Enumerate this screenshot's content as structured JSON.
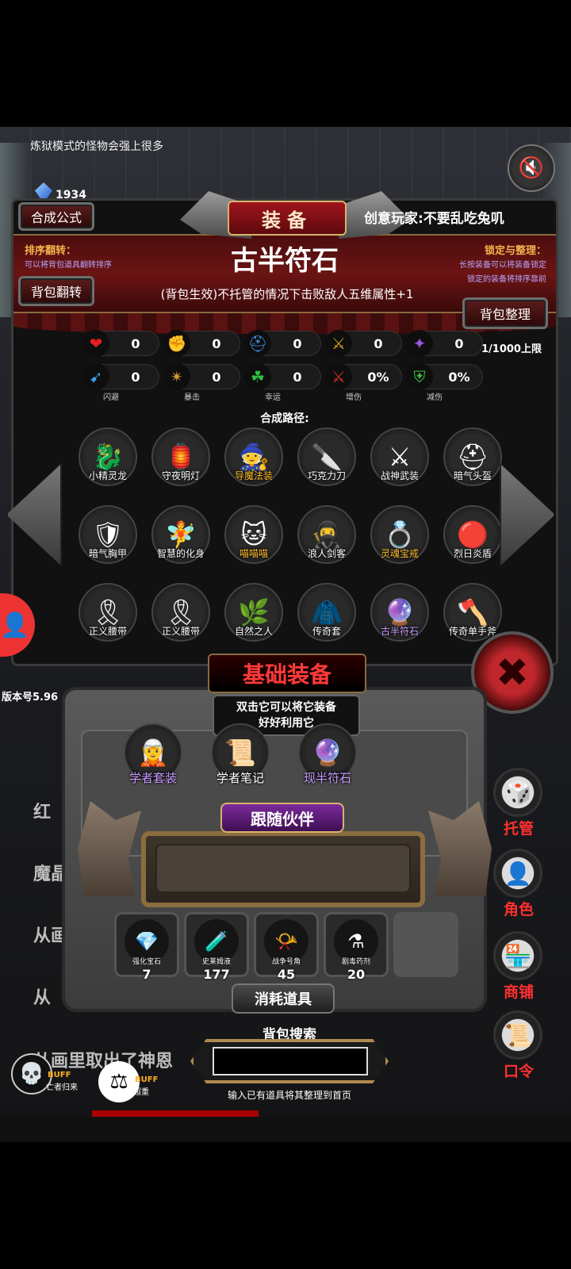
{
  "hint": "炼狱模式的怪物会强上很多",
  "currency": {
    "gems": "1934"
  },
  "header": {
    "title": "装备",
    "player": "创意玩家:不要乱吃兔叽",
    "synth_btn": "合成公式",
    "flip_label": "排序翻转：",
    "flip_sub": "可以将背包道具翻转排序",
    "flip_btn": "背包翻转",
    "lock_label": "锁定与整理：",
    "lock_sub1": "长按装备可以将装备锁定",
    "lock_sub2": "锁定的装备将排序靠前",
    "sort_btn": "背包整理"
  },
  "item": {
    "name": "古半符石",
    "desc": "(背包生效)不托管的情况下击败敌人五维属性+1"
  },
  "stats": [
    {
      "icon": "heart-icon",
      "glyph": "❤",
      "color": "#e02020",
      "value": "0",
      "label": ""
    },
    {
      "icon": "strength-icon",
      "glyph": "✊",
      "color": "#e4b526",
      "value": "0",
      "label": ""
    },
    {
      "icon": "helmet-icon",
      "glyph": "⛑",
      "color": "#3a8fe0",
      "value": "0",
      "label": ""
    },
    {
      "icon": "sword-icon",
      "glyph": "⚔",
      "color": "#d9a020",
      "value": "0",
      "label": ""
    },
    {
      "icon": "magic-icon",
      "glyph": "✦",
      "color": "#9b58e6",
      "value": "0",
      "label": ""
    },
    {
      "icon": "dodge-icon",
      "glyph": "➹",
      "color": "#3aa0f0",
      "value": "0",
      "label": "闪避"
    },
    {
      "icon": "crit-icon",
      "glyph": "✴",
      "color": "#e0a030",
      "value": "0",
      "label": "暴击"
    },
    {
      "icon": "luck-icon",
      "glyph": "☘",
      "color": "#30c040",
      "value": "0",
      "label": "幸运"
    },
    {
      "icon": "damage-up-icon",
      "glyph": "⚔",
      "color": "#e03030",
      "value": "0%",
      "label": "增伤"
    },
    {
      "icon": "shield-icon",
      "glyph": "⛨",
      "color": "#40c040",
      "value": "0%",
      "label": "减伤"
    }
  ],
  "stat_limit": "1/1000上限",
  "path_label": "合成路径:",
  "recipe": [
    {
      "name": "小精灵龙",
      "glyph": "🐉",
      "style": ""
    },
    {
      "name": "守夜明灯",
      "glyph": "🏮",
      "style": ""
    },
    {
      "name": "导魔法装",
      "glyph": "🧙",
      "style": "hl"
    },
    {
      "name": "巧克力刀",
      "glyph": "🔪",
      "style": ""
    },
    {
      "name": "战神武装",
      "glyph": "⚔",
      "style": ""
    },
    {
      "name": "暗气头盔",
      "glyph": "⛑",
      "style": ""
    },
    {
      "name": "暗气胸甲",
      "glyph": "🛡",
      "style": ""
    },
    {
      "name": "智慧的化身",
      "glyph": "🧚",
      "style": ""
    },
    {
      "name": "喵喵喵",
      "glyph": "🐱",
      "style": "hl"
    },
    {
      "name": "浪人剑客",
      "glyph": "🥷",
      "style": ""
    },
    {
      "name": "灵魂宝戒",
      "glyph": "💍",
      "style": "hl"
    },
    {
      "name": "烈日炎盾",
      "glyph": "🔴",
      "style": ""
    },
    {
      "name": "正义腰带",
      "glyph": "🎗",
      "style": ""
    },
    {
      "name": "正义腰带",
      "glyph": "🎗",
      "style": ""
    },
    {
      "name": "自然之人",
      "glyph": "🌿",
      "style": ""
    },
    {
      "name": "传奇套",
      "glyph": "🧥",
      "style": ""
    },
    {
      "name": "古半符石",
      "glyph": "🔮",
      "style": "pr"
    },
    {
      "name": "传奇单手斧",
      "glyph": "🪓",
      "style": ""
    }
  ],
  "version": "版本号5.96",
  "base": {
    "title": "基础装备",
    "desc1": "双击它可以将它装备",
    "desc2": "好好利用它",
    "items": [
      {
        "name": "学者套装",
        "glyph": "🧝",
        "style": "pr"
      },
      {
        "name": "学者笔记",
        "glyph": "📜",
        "style": ""
      },
      {
        "name": "现半符石",
        "glyph": "🔮",
        "style": "pr"
      }
    ]
  },
  "companion": "跟随伙伴",
  "consumables": {
    "label": "消耗道具",
    "items": [
      {
        "name": "强化宝石",
        "glyph": "💎",
        "count": "7"
      },
      {
        "name": "史莱姆液",
        "glyph": "🧪",
        "count": "177"
      },
      {
        "name": "战争号角",
        "glyph": "📯",
        "count": "45"
      },
      {
        "name": "剧毒药剂",
        "glyph": "⚗",
        "count": "20"
      },
      {
        "name": "",
        "glyph": "",
        "count": ""
      }
    ]
  },
  "side_menu": [
    {
      "label": "托管",
      "glyph": "🎲"
    },
    {
      "label": "角色",
      "glyph": "👤"
    },
    {
      "label": "商铺",
      "glyph": "🏪"
    },
    {
      "label": "口令",
      "glyph": "📜"
    }
  ],
  "log": [
    "红",
    "魔晶",
    "从画",
    "从",
    "从画里取出了神恩"
  ],
  "search": {
    "label": "背包搜索",
    "placeholder": "",
    "hint": "输入已有道具将其整理到首页"
  },
  "buffs": [
    {
      "tag": "BUFF",
      "sub": "亡者归来",
      "glyph": "💀"
    },
    {
      "tag": "BUFF",
      "sub": "超重",
      "glyph": "⚖"
    }
  ]
}
